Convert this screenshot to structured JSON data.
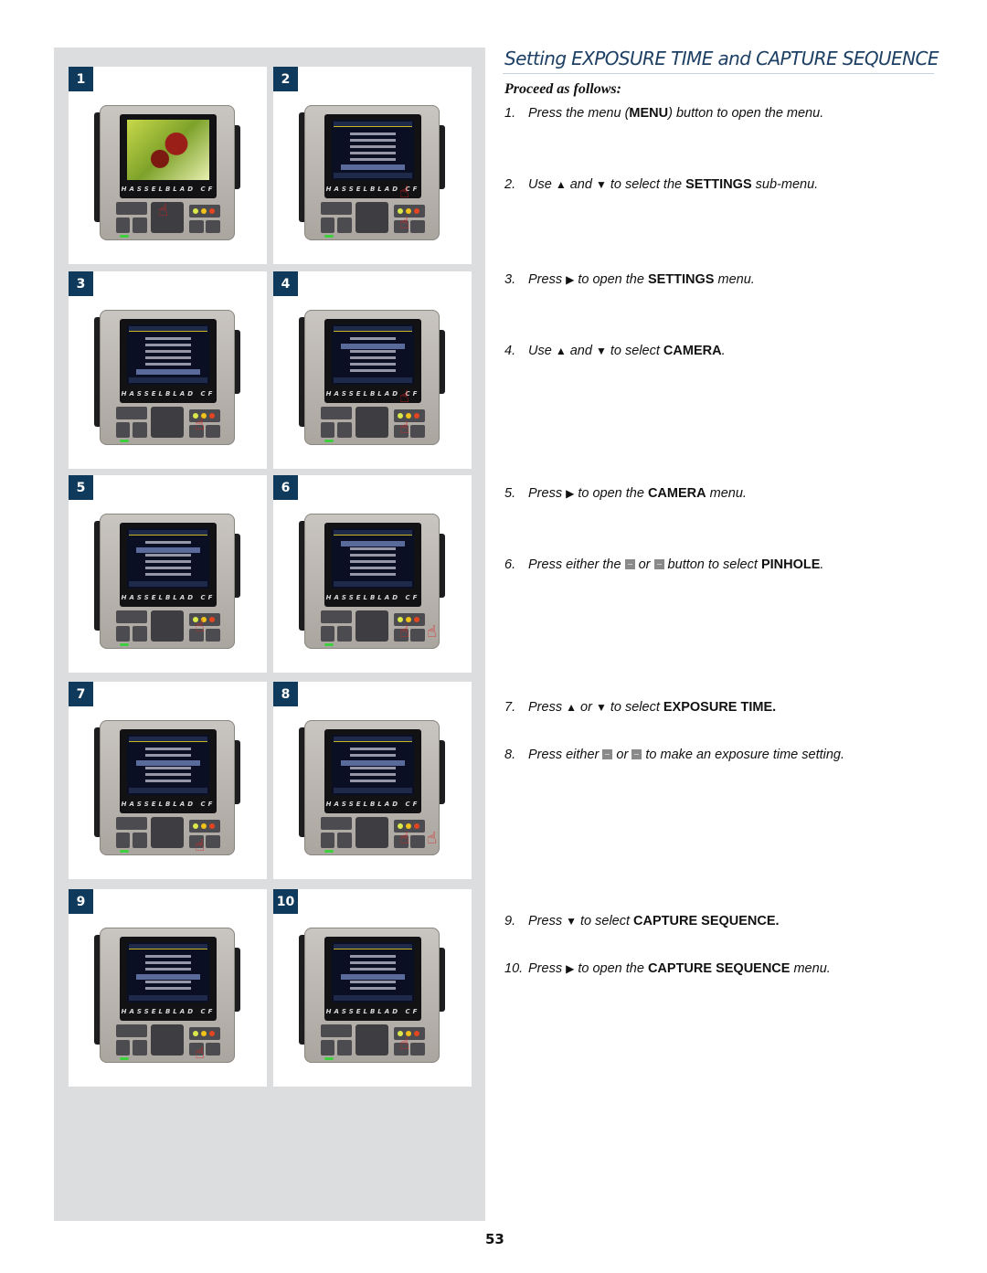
{
  "title": "Setting EXPOSURE TIME and CAPTURE SEQUENCE",
  "intro": "Proceed as follows:",
  "panels": [
    {
      "badge": "1",
      "screen": "image",
      "brand": "HASSELBLAD CF"
    },
    {
      "badge": "2",
      "screen": "menu",
      "brand": "HASSELBLAD CF"
    },
    {
      "badge": "3",
      "screen": "menu",
      "brand": "HASSELBLAD CF"
    },
    {
      "badge": "4",
      "screen": "menu",
      "brand": "HASSELBLAD CF"
    },
    {
      "badge": "5",
      "screen": "menu",
      "brand": "HASSELBLAD CF"
    },
    {
      "badge": "6",
      "screen": "menu",
      "brand": "HASSELBLAD CF"
    },
    {
      "badge": "7",
      "screen": "menu",
      "brand": "HASSELBLAD CF"
    },
    {
      "badge": "8",
      "screen": "menu",
      "brand": "HASSELBLAD CF"
    },
    {
      "badge": "9",
      "screen": "menu",
      "brand": "HASSELBLAD CF"
    },
    {
      "badge": "10",
      "screen": "menu",
      "brand": "HASSELBLAD CF"
    }
  ],
  "steps": [
    {
      "num": "1.",
      "parts": [
        [
          "t",
          "Press the menu ("
        ],
        [
          "b",
          "MENU"
        ],
        [
          "t",
          ") button to open the menu."
        ]
      ]
    },
    {
      "num": "2.",
      "parts": [
        [
          "t",
          "Use "
        ],
        [
          "s",
          "▲"
        ],
        [
          "t",
          " and "
        ],
        [
          "s",
          "▼"
        ],
        [
          "t",
          " to select the "
        ],
        [
          "b",
          "SETTINGS"
        ],
        [
          "t",
          " sub-menu."
        ]
      ]
    },
    {
      "num": "3.",
      "parts": [
        [
          "t",
          "Press "
        ],
        [
          "s",
          "▶"
        ],
        [
          "t",
          " to open the "
        ],
        [
          "b",
          "SETTINGS"
        ],
        [
          "t",
          " menu."
        ]
      ]
    },
    {
      "num": "4.",
      "parts": [
        [
          "t",
          "Use "
        ],
        [
          "s",
          "▲"
        ],
        [
          "t",
          " and "
        ],
        [
          "s",
          "▼"
        ],
        [
          "t",
          " to select "
        ],
        [
          "b",
          "CAMERA"
        ],
        [
          "t",
          "."
        ]
      ]
    },
    {
      "num": "5.",
      "parts": [
        [
          "t",
          "Press "
        ],
        [
          "s",
          "▶"
        ],
        [
          "t",
          " to open the "
        ],
        [
          "b",
          "CAMERA"
        ],
        [
          "t",
          " menu."
        ]
      ]
    },
    {
      "num": "6.",
      "parts": [
        [
          "t",
          "Press either the "
        ],
        [
          "i",
          "plus-button-icon"
        ],
        [
          "t",
          " or "
        ],
        [
          "i",
          "minus-button-icon"
        ],
        [
          "t",
          " button to select "
        ],
        [
          "b",
          "PINHOLE"
        ],
        [
          "t",
          "."
        ]
      ]
    },
    {
      "num": "7.",
      "parts": [
        [
          "t",
          "Press "
        ],
        [
          "s",
          "▲"
        ],
        [
          "t",
          " or "
        ],
        [
          "s",
          "▼"
        ],
        [
          "t",
          " to select "
        ],
        [
          "b",
          "EXPOSURE TIME."
        ]
      ]
    },
    {
      "num": "8.",
      "parts": [
        [
          "t",
          "Press either "
        ],
        [
          "i",
          "plus-button-icon"
        ],
        [
          "t",
          " or "
        ],
        [
          "i",
          "minus-button-icon"
        ],
        [
          "t",
          " to make an exposure time setting."
        ]
      ]
    },
    {
      "num": "9.",
      "parts": [
        [
          "t",
          "Press "
        ],
        [
          "s",
          "▼"
        ],
        [
          "t",
          " to select "
        ],
        [
          "b",
          "CAPTURE SEQUENCE."
        ]
      ]
    },
    {
      "num": "10.",
      "parts": [
        [
          "t",
          "Press "
        ],
        [
          "s",
          "▶"
        ],
        [
          "t",
          " to open the "
        ],
        [
          "b",
          "CAPTURE SEQUENCE"
        ],
        [
          "t",
          " menu."
        ]
      ]
    }
  ],
  "page_number": "53",
  "colors": {
    "title": "#1d3f63",
    "badge": "#0f3a5c",
    "panel_bg": "#dcdddf"
  }
}
